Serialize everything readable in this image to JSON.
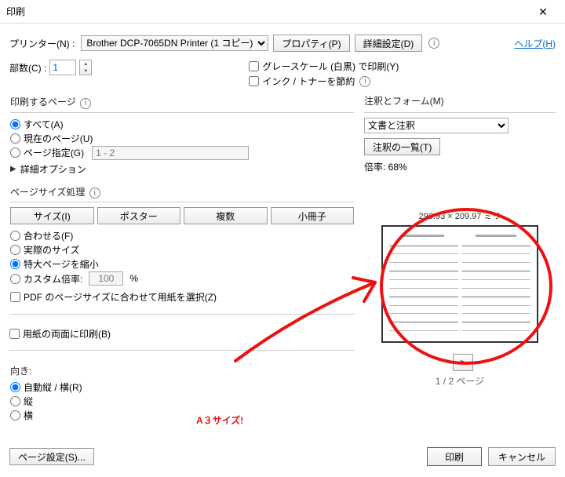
{
  "title": "印刷",
  "printerLabel": "プリンター(N) :",
  "printer": "Brother DCP-7065DN Printer (1 コピー)",
  "propertiesBtn": "プロパティ(P)",
  "advancedBtn": "詳細設定(D)",
  "helpLink": "ヘルプ(H)",
  "copiesLabel": "部数(C) :",
  "copiesValue": "1",
  "grayscale": "グレースケール (白黒) で印刷(Y)",
  "saveInk": "インク / トナーを節約",
  "pagesGroup": "印刷するページ",
  "optAll": "すべて(A)",
  "optCurrent": "現在のページ(U)",
  "optPages": "ページ指定(G)",
  "pagesRange": "1 - 2",
  "detailOptions": "詳細オプション",
  "sizeGroup": "ページサイズ処理",
  "btnSize": "サイズ(I)",
  "btnPoster": "ポスター",
  "btnMultiple": "複数",
  "btnBooklet": "小冊子",
  "optFit": "合わせる(F)",
  "optActual": "実際のサイズ",
  "optShrink": "特大ページを縮小",
  "optCustom": "カスタム倍率:",
  "customVal": "100",
  "customPct": "%",
  "chkPdfSize": "PDF のページサイズに合わせて用紙を選択(Z)",
  "chkDuplex": "用紙の両面に印刷(B)",
  "orientLabel": "向き:",
  "orientAuto": "自動縦 / 横(R)",
  "orientPortrait": "縦",
  "orientLandscape": "横",
  "commentsGroup": "注釈とフォーム(M)",
  "commentsSel": "文書と注釈",
  "commentsListBtn": "注釈の一覧(T)",
  "scaleLabel": "倍率: 68%",
  "previewDim": "296.93 × 209.97 ミリ",
  "pageIndicator": "1 / 2 ページ",
  "navNext": ">",
  "pageSetupBtn": "ページ設定(S)...",
  "printBtn": "印刷",
  "cancelBtn": "キャンセル",
  "annotation": "A３サイズ!"
}
